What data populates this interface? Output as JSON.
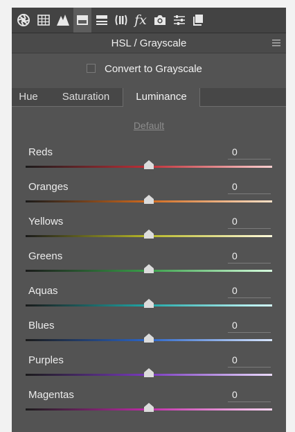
{
  "toolbar": {
    "icons": [
      "aperture-icon",
      "grid-icon",
      "tone-curve-icon",
      "hsl-icon",
      "split-toning-icon",
      "lens-corrections-icon",
      "fx-icon",
      "camera-calibration-icon",
      "sliders-icon",
      "snapshots-icon"
    ],
    "fx_label": "fx",
    "active_icon": "hsl-icon"
  },
  "panel": {
    "title": "HSL / Grayscale"
  },
  "grayscale": {
    "label": "Convert to Grayscale",
    "checked": false
  },
  "tabs": [
    {
      "label": "Hue",
      "active": false
    },
    {
      "label": "Saturation",
      "active": false
    },
    {
      "label": "Luminance",
      "active": true
    }
  ],
  "default_link": "Default",
  "sliders": [
    {
      "label": "Reds",
      "value": "0",
      "gradient": [
        "#1a1a1a",
        "#c03038",
        "#ffd0d0"
      ]
    },
    {
      "label": "Oranges",
      "value": "0",
      "gradient": [
        "#1a1a1a",
        "#d06a1e",
        "#ffe2c8"
      ]
    },
    {
      "label": "Yellows",
      "value": "0",
      "gradient": [
        "#1a1a1a",
        "#b8b828",
        "#fffadc"
      ]
    },
    {
      "label": "Greens",
      "value": "0",
      "gradient": [
        "#1a1a1a",
        "#3aa04a",
        "#d8ffe0"
      ]
    },
    {
      "label": "Aquas",
      "value": "0",
      "gradient": [
        "#1a1a1a",
        "#20a8a8",
        "#d4ffff"
      ]
    },
    {
      "label": "Blues",
      "value": "0",
      "gradient": [
        "#1a1a1a",
        "#2c66c8",
        "#d8e6ff"
      ]
    },
    {
      "label": "Purples",
      "value": "0",
      "gradient": [
        "#1a1a1a",
        "#7a3ac0",
        "#ecdcff"
      ]
    },
    {
      "label": "Magentas",
      "value": "0",
      "gradient": [
        "#1a1a1a",
        "#c02ca8",
        "#ffd8f4"
      ]
    }
  ]
}
